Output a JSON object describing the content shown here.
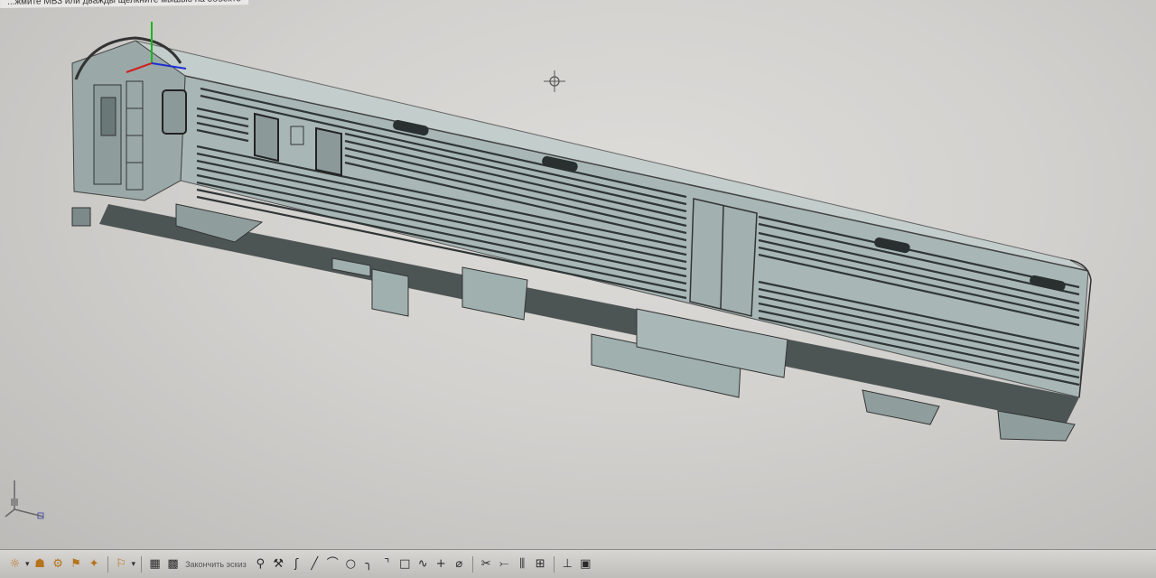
{
  "window": {
    "hint_text": "...жмите МВЗ или дважды щелкните мышью на объекте"
  },
  "viewport": {
    "model": "railway-baggage-car-3d-model",
    "background_color": "#d6d4d1",
    "model_color": "#a3b3b2"
  },
  "toolbar": {
    "finish_sketch_label": "Закончить эскиз",
    "tools": [
      {
        "name": "smart-dimension-icon",
        "glyph": "⚲"
      },
      {
        "name": "relations-icon",
        "glyph": "⚒"
      },
      {
        "name": "sketch-icon",
        "glyph": "ʃ"
      },
      {
        "name": "line-icon",
        "glyph": "╱"
      },
      {
        "name": "arc-icon",
        "glyph": "⌒"
      },
      {
        "name": "circle-icon",
        "glyph": "○"
      },
      {
        "name": "fillet-icon",
        "glyph": "╮"
      },
      {
        "name": "chamfer-icon",
        "glyph": "⌝"
      },
      {
        "name": "rectangle-icon",
        "glyph": "□"
      },
      {
        "name": "spline-icon",
        "glyph": "∿"
      },
      {
        "name": "point-icon",
        "glyph": "+"
      },
      {
        "name": "offset-icon",
        "glyph": "⌀"
      },
      {
        "name": "trim-icon",
        "glyph": "✂"
      },
      {
        "name": "extend-icon",
        "glyph": "⤚"
      },
      {
        "name": "mirror-icon",
        "glyph": "⫼"
      },
      {
        "name": "pattern-icon",
        "glyph": "⊞"
      },
      {
        "name": "constraint-icon",
        "glyph": "⊥"
      },
      {
        "name": "display-icon",
        "glyph": "▣"
      }
    ]
  }
}
